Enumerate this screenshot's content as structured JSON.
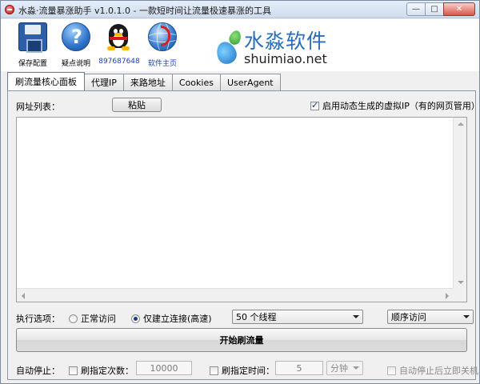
{
  "window": {
    "title": "水淼·流量暴涨助手 v1.0.1.0 - 一款短时间让流量极速暴涨的工具",
    "buttons": {
      "minimize": "—",
      "maximize": "□",
      "close": "✕"
    }
  },
  "toolbar": {
    "save_label": "保存配置",
    "help_label": "疑点说明",
    "qq_label": "897687648",
    "site_label": "软件主页",
    "brand_cn": "水淼软件",
    "brand_en": "shuimiao.net"
  },
  "tabs": [
    "刷流量核心面板",
    "代理IP",
    "来路地址",
    "Cookies",
    "UserAgent"
  ],
  "panel": {
    "url_list_label": "网址列表：",
    "paste_button": "粘贴",
    "virtual_ip_label": "启用动态生成的虚拟IP（有的网页管用）",
    "virtual_ip_checked": true,
    "exec_label": "执行选项：",
    "radio_normal": "正常访问",
    "radio_connect": "仅建立连接(高速)",
    "radio_selected": "connect",
    "threads_value": "50 个线程",
    "order_value": "顺序访问",
    "start_button": "开始刷流量",
    "auto_stop_label": "自动停止：",
    "count_label": "刷指定次数：",
    "count_value": "10000",
    "time_label": "刷指定时间：",
    "time_value": "5",
    "time_unit": "分钟",
    "shutdown_label": "自动停止后立即关机"
  }
}
